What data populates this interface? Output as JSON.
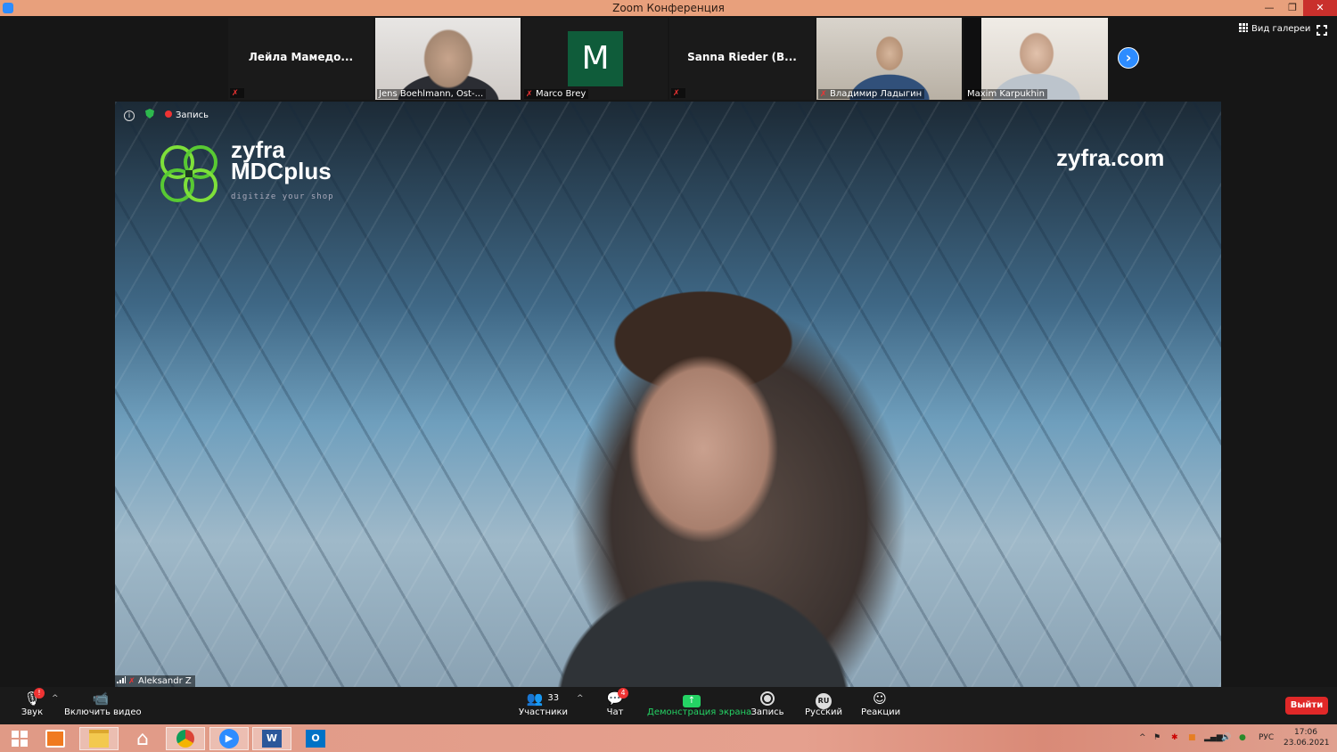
{
  "window": {
    "title": "Zoom Конференция",
    "minimize": "—",
    "restore": "❐",
    "close": "✕"
  },
  "participants_strip": [
    {
      "name": "Лейла Мамедо...",
      "kind": "name-only"
    },
    {
      "name": "Jens Boehlmann, Ost-...",
      "kind": "video"
    },
    {
      "name": "Marco Brey",
      "avatar_letter": "M",
      "kind": "avatar"
    },
    {
      "name": "Sanna Rieder (B...",
      "kind": "name-only"
    },
    {
      "name": "Владимир Ладыгин",
      "kind": "video"
    },
    {
      "name": "Maxim Karpukhin",
      "kind": "video"
    }
  ],
  "view": {
    "gallery_label": "Вид галереи",
    "next_icon": "›"
  },
  "speaker": {
    "name": "Aleksandr Z",
    "recording_label": "Запись",
    "logo_line1": "zyfra",
    "logo_line2": "MDCplus",
    "logo_tagline": "digitize your shop",
    "site": "zyfra.com"
  },
  "toolbar": {
    "audio": "Звук",
    "video": "Включить видео",
    "participants": "Участники",
    "participants_count": "33",
    "chat": "Чат",
    "chat_badge": "4",
    "share": "Демонстрация экрана",
    "record": "Запись",
    "language": "Русский",
    "language_code": "RU",
    "reactions": "Реакции",
    "leave": "Выйти",
    "audio_badge": "!"
  },
  "taskbar": {
    "lang": "РУС",
    "time": "17:06",
    "date": "23.06.2021"
  },
  "colors": {
    "accent": "#2d8cff",
    "share_green": "#24d364",
    "leave_red": "#e02828",
    "titlebar": "#e8a07c"
  }
}
